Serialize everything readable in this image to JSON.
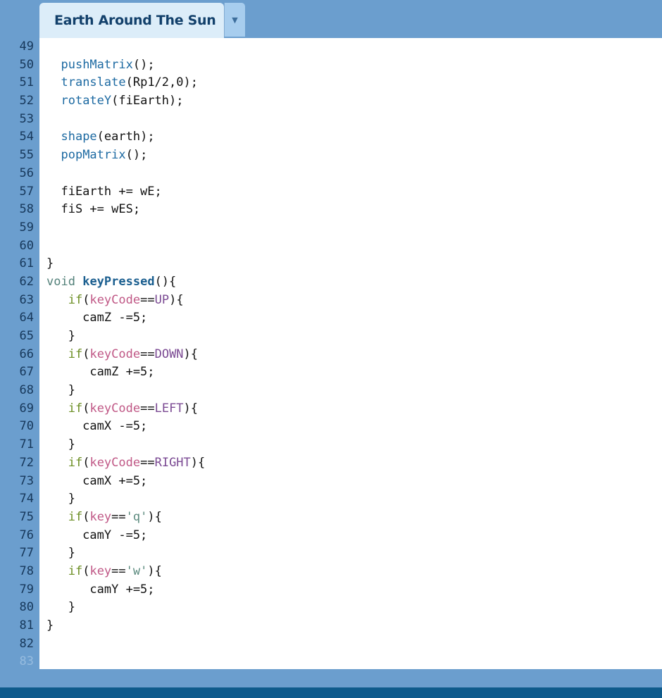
{
  "tab": {
    "title": "Earth Around The Sun",
    "menu_icon": "▼"
  },
  "editor": {
    "line_numbers": [
      "49",
      "50",
      "51",
      "52",
      "53",
      "54",
      "55",
      "56",
      "57",
      "58",
      "59",
      "60",
      "61",
      "62",
      "63",
      "64",
      "65",
      "66",
      "67",
      "68",
      "69",
      "70",
      "71",
      "72",
      "73",
      "74",
      "75",
      "76",
      "77",
      "78",
      "79",
      "80",
      "81",
      "82",
      "83"
    ],
    "lines": [
      [],
      [
        {
          "t": "  "
        },
        {
          "t": "pushMatrix",
          "c": "fn"
        },
        {
          "t": "();"
        }
      ],
      [
        {
          "t": "  "
        },
        {
          "t": "translate",
          "c": "fn"
        },
        {
          "t": "(Rp1/2,0);"
        }
      ],
      [
        {
          "t": "  "
        },
        {
          "t": "rotateY",
          "c": "fn"
        },
        {
          "t": "(fiEarth);"
        }
      ],
      [],
      [
        {
          "t": "  "
        },
        {
          "t": "shape",
          "c": "fn"
        },
        {
          "t": "(earth);"
        }
      ],
      [
        {
          "t": "  "
        },
        {
          "t": "popMatrix",
          "c": "fn"
        },
        {
          "t": "();"
        }
      ],
      [],
      [
        {
          "t": "  fiEarth += wE;"
        }
      ],
      [
        {
          "t": "  fiS += wES;"
        }
      ],
      [],
      [],
      [
        {
          "t": "}"
        }
      ],
      [
        {
          "t": "void",
          "c": "kw"
        },
        {
          "t": " "
        },
        {
          "t": "keyPressed",
          "c": "kwb"
        },
        {
          "t": "(){"
        }
      ],
      [
        {
          "t": "   "
        },
        {
          "t": "if",
          "c": "ctl"
        },
        {
          "t": "("
        },
        {
          "t": "keyCode",
          "c": "var"
        },
        {
          "t": "=="
        },
        {
          "t": "UP",
          "c": "const"
        },
        {
          "t": "){"
        }
      ],
      [
        {
          "t": "     camZ -=5;"
        }
      ],
      [
        {
          "t": "   }"
        }
      ],
      [
        {
          "t": "   "
        },
        {
          "t": "if",
          "c": "ctl"
        },
        {
          "t": "("
        },
        {
          "t": "keyCode",
          "c": "var"
        },
        {
          "t": "=="
        },
        {
          "t": "DOWN",
          "c": "const"
        },
        {
          "t": "){"
        }
      ],
      [
        {
          "t": "      camZ +=5;"
        }
      ],
      [
        {
          "t": "   }"
        }
      ],
      [
        {
          "t": "   "
        },
        {
          "t": "if",
          "c": "ctl"
        },
        {
          "t": "("
        },
        {
          "t": "keyCode",
          "c": "var"
        },
        {
          "t": "=="
        },
        {
          "t": "LEFT",
          "c": "const"
        },
        {
          "t": "){"
        }
      ],
      [
        {
          "t": "     camX -=5;"
        }
      ],
      [
        {
          "t": "   }"
        }
      ],
      [
        {
          "t": "   "
        },
        {
          "t": "if",
          "c": "ctl"
        },
        {
          "t": "("
        },
        {
          "t": "keyCode",
          "c": "var"
        },
        {
          "t": "=="
        },
        {
          "t": "RIGHT",
          "c": "const"
        },
        {
          "t": "){"
        }
      ],
      [
        {
          "t": "     camX +=5;"
        }
      ],
      [
        {
          "t": "   }"
        }
      ],
      [
        {
          "t": "   "
        },
        {
          "t": "if",
          "c": "ctl"
        },
        {
          "t": "("
        },
        {
          "t": "key",
          "c": "var"
        },
        {
          "t": "=="
        },
        {
          "t": "'q'",
          "c": "str"
        },
        {
          "t": "){"
        }
      ],
      [
        {
          "t": "     camY -=5;"
        }
      ],
      [
        {
          "t": "   }"
        }
      ],
      [
        {
          "t": "   "
        },
        {
          "t": "if",
          "c": "ctl"
        },
        {
          "t": "("
        },
        {
          "t": "key",
          "c": "var"
        },
        {
          "t": "=="
        },
        {
          "t": "'w'",
          "c": "str"
        },
        {
          "t": "){"
        }
      ],
      [
        {
          "t": "      camY +=5;"
        }
      ],
      [
        {
          "t": "   }"
        }
      ],
      [
        {
          "t": "}"
        }
      ],
      [],
      []
    ]
  },
  "colors": {
    "frame": "#6b9ece",
    "tab_background": "#dcedf9",
    "tab_text": "#12406b",
    "bottom_bar": "#0e5b8c",
    "function": "#1d6aa2",
    "keyword": "#53817a",
    "control": "#6b8e23",
    "variable": "#c05886",
    "constant": "#7b4a93"
  }
}
